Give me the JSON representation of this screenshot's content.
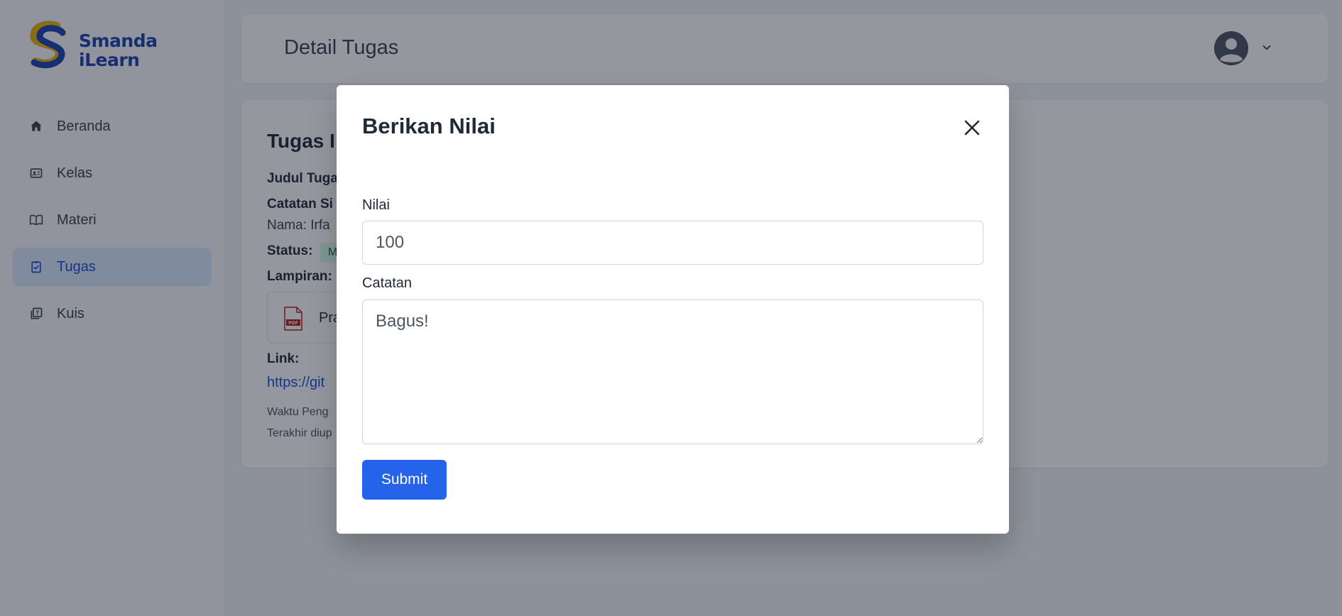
{
  "sidebar": {
    "logo": {
      "line1": "Smanda",
      "line2": "iLearn"
    },
    "items": [
      {
        "label": "Beranda",
        "icon": "home-icon"
      },
      {
        "label": "Kelas",
        "icon": "class-icon"
      },
      {
        "label": "Materi",
        "icon": "book-icon"
      },
      {
        "label": "Tugas",
        "icon": "clipboard-check-icon",
        "active": true
      },
      {
        "label": "Kuis",
        "icon": "quiz-icon"
      }
    ]
  },
  "header": {
    "title": "Detail Tugas",
    "avatar_icon": "user-avatar-icon",
    "menu_icon": "chevron-down-icon"
  },
  "card": {
    "title": "Tugas I",
    "judul_label": "Judul Tuga",
    "catatan_label": "Catatan Si",
    "nama_text": "Nama: Irfa",
    "status_label": "Status:",
    "status_badge": "M",
    "lampiran_label": "Lampiran:",
    "attachment_name": "Pra",
    "link_label": "Link:",
    "link_text": "https://git",
    "waktu_text": "Waktu Peng",
    "terakhir_text": "Terakhir diup"
  },
  "modal": {
    "title": "Berikan Nilai",
    "close_icon": "close-icon",
    "nilai_label": "Nilai",
    "nilai_value": "100",
    "catatan_label": "Catatan",
    "catatan_value": "Bagus!",
    "submit_label": "Submit"
  },
  "colors": {
    "brand_blue": "#1e40af",
    "brand_yellow": "#eab308",
    "primary_button": "#2563eb",
    "active_nav_bg": "#dbeafe"
  }
}
